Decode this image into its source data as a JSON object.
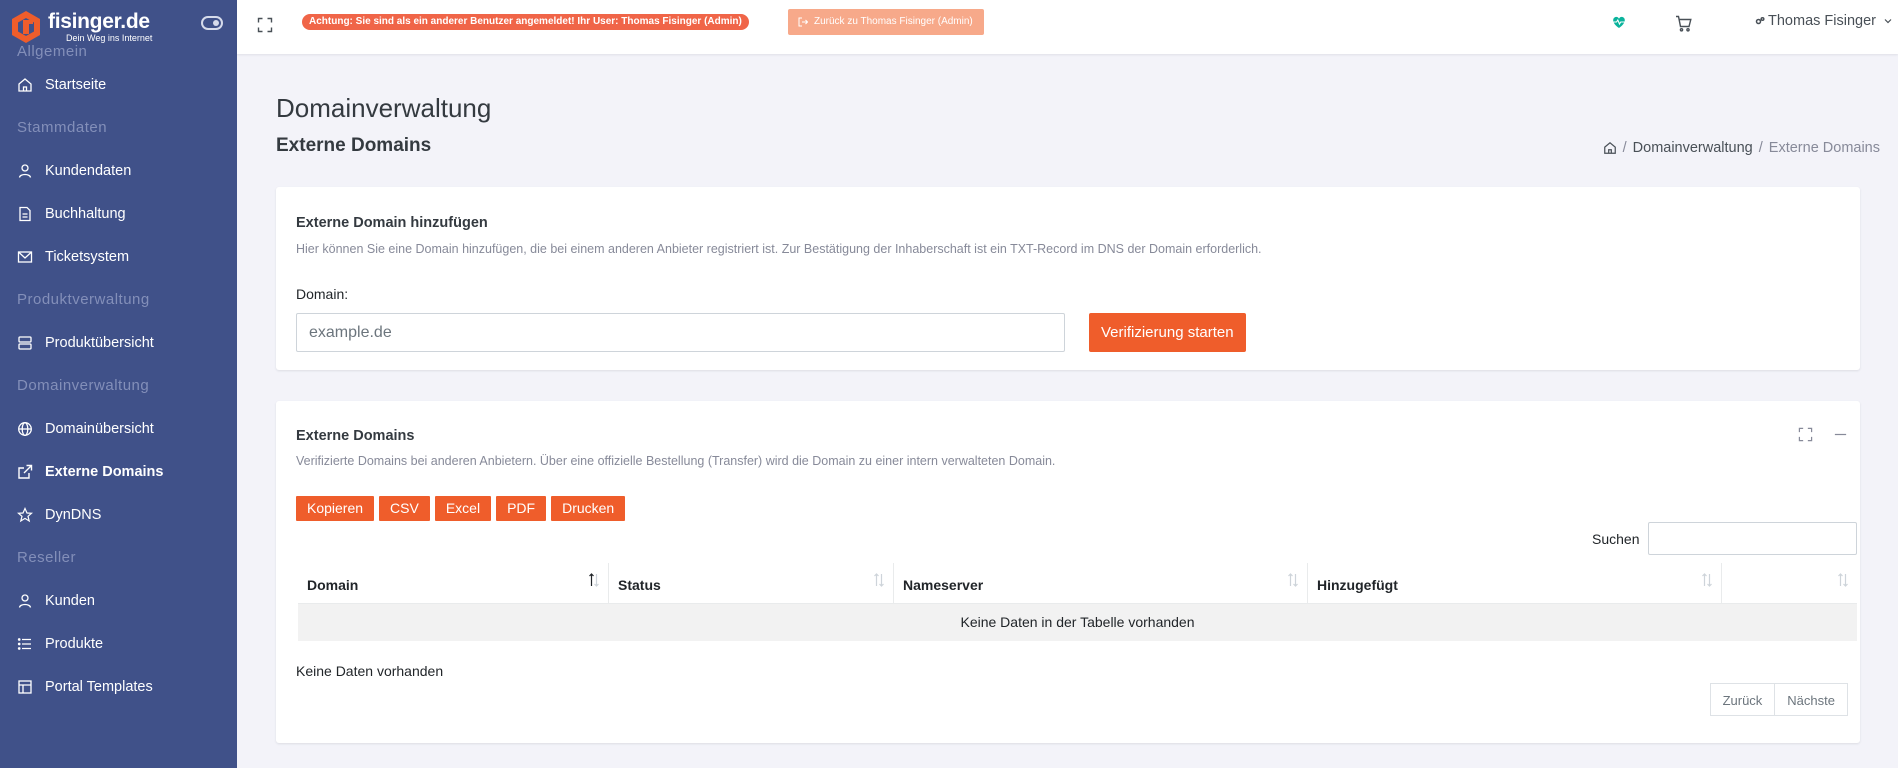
{
  "brand": {
    "name": "fisinger.de",
    "tagline": "Dein Weg ins Internet"
  },
  "sidebar": {
    "sections": [
      {
        "title": "Allgemein",
        "items": [
          {
            "label": "Startseite",
            "icon": "home-icon"
          }
        ]
      },
      {
        "title": "Stammdaten",
        "items": [
          {
            "label": "Kundendaten",
            "icon": "user-icon"
          },
          {
            "label": "Buchhaltung",
            "icon": "document-icon"
          },
          {
            "label": "Ticketsystem",
            "icon": "mail-icon"
          }
        ]
      },
      {
        "title": "Produktverwaltung",
        "items": [
          {
            "label": "Produktübersicht",
            "icon": "server-icon"
          }
        ]
      },
      {
        "title": "Domainverwaltung",
        "items": [
          {
            "label": "Domainübersicht",
            "icon": "globe-icon"
          },
          {
            "label": "Externe Domains",
            "icon": "external-link-icon",
            "active": true
          },
          {
            "label": "DynDNS",
            "icon": "star-icon"
          }
        ]
      },
      {
        "title": "Reseller",
        "items": [
          {
            "label": "Kunden",
            "icon": "user-icon"
          },
          {
            "label": "Produkte",
            "icon": "list-icon"
          },
          {
            "label": "Portal Templates",
            "icon": "layout-icon"
          }
        ]
      }
    ]
  },
  "topbar": {
    "warning": "Achtung: Sie sind als ein anderer Benutzer angemeldet! Ihr User: Thomas Fisinger (Admin)",
    "back_button": "Zurück zu Thomas Fisinger (Admin)",
    "user_name": "Thomas Fisinger"
  },
  "page": {
    "title": "Domainverwaltung",
    "subtitle": "Externe Domains",
    "breadcrumb": {
      "parent": "Domainverwaltung",
      "current": "Externe Domains"
    }
  },
  "add_card": {
    "title": "Externe Domain hinzufügen",
    "description": "Hier können Sie eine Domain hinzufügen, die bei einem anderen Anbieter registriert ist. Zur Bestätigung der Inhaberschaft ist ein TXT-Record im DNS der Domain erforderlich.",
    "field_label": "Domain:",
    "placeholder": "example.de",
    "submit_label": "Verifizierung starten"
  },
  "list_card": {
    "title": "Externe Domains",
    "description": "Verifizierte Domains bei anderen Anbietern. Über eine offizielle Bestellung (Transfer) wird die Domain zu einer intern verwalteten Domain.",
    "export_buttons": [
      "Kopieren",
      "CSV",
      "Excel",
      "PDF",
      "Drucken"
    ],
    "search_label": "Suchen",
    "columns": [
      "Domain",
      "Status",
      "Nameserver",
      "Hinzugefügt",
      ""
    ],
    "empty_message": "Keine Daten in der Tabelle vorhanden",
    "info": "Keine Daten vorhanden",
    "pager": {
      "prev": "Zurück",
      "next": "Nächste"
    }
  },
  "colors": {
    "sidebar": "#405189",
    "accent": "#ef5d2b",
    "warning": "#f06548"
  }
}
